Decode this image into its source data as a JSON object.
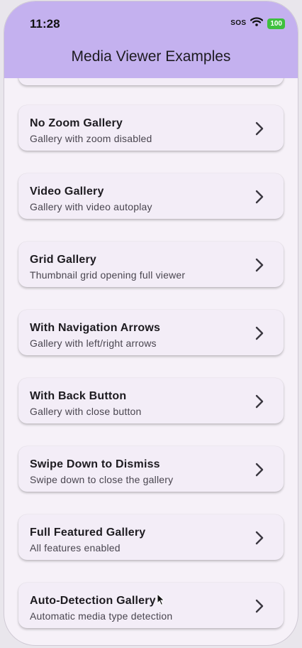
{
  "status_bar": {
    "time": "11:28",
    "sos": "SOS",
    "battery": "100"
  },
  "app_bar": {
    "title": "Media Viewer Examples"
  },
  "items": [
    {
      "title": "No Zoom Gallery",
      "subtitle": "Gallery with zoom disabled"
    },
    {
      "title": "Video Gallery",
      "subtitle": "Gallery with video autoplay"
    },
    {
      "title": "Grid Gallery",
      "subtitle": "Thumbnail grid opening full viewer"
    },
    {
      "title": "With Navigation Arrows",
      "subtitle": "Gallery with left/right arrows"
    },
    {
      "title": "With Back Button",
      "subtitle": "Gallery with close button"
    },
    {
      "title": "Swipe Down to Dismiss",
      "subtitle": "Swipe down to close the gallery"
    },
    {
      "title": "Full Featured Gallery",
      "subtitle": "All features enabled"
    },
    {
      "title": "Auto-Detection Gallery",
      "subtitle": "Automatic media type detection"
    }
  ],
  "colors": {
    "app_bar": "#c4b1ef",
    "background": "#f6f1f8",
    "card": "#f3edf7",
    "battery": "#3fc03f"
  },
  "icons": {
    "chevron": "chevron-right-icon",
    "wifi": "wifi-icon",
    "battery": "battery-icon"
  }
}
